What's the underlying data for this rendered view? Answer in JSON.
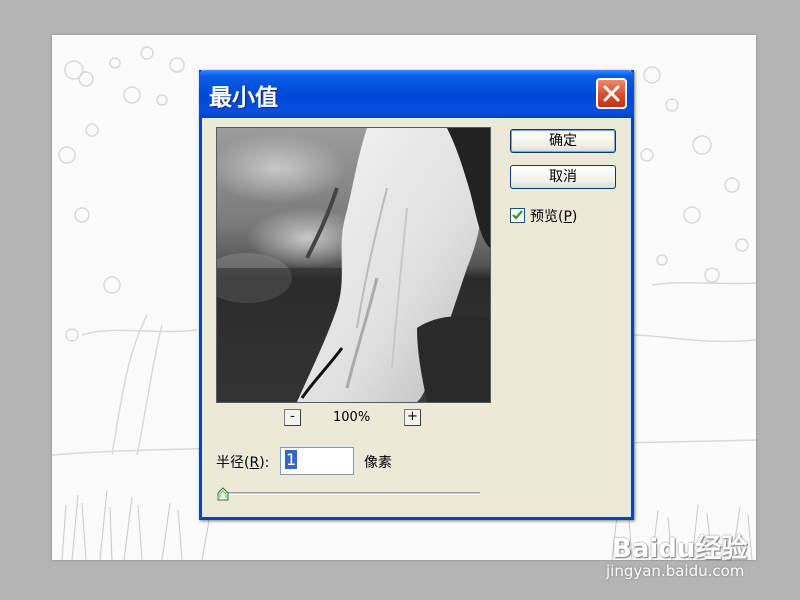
{
  "dialog": {
    "title": "最小值",
    "close_icon": "close-x-icon",
    "ok_label": "确定",
    "cancel_label": "取消",
    "preview_checkbox": {
      "checked": true,
      "label_prefix": "预览(",
      "mnemonic": "P",
      "label_suffix": ")"
    },
    "zoom": {
      "minus_label": "-",
      "plus_label": "+",
      "level": "100%"
    },
    "radius": {
      "label_prefix": "半径(",
      "mnemonic": "R",
      "label_suffix": "):",
      "value": "1",
      "unit": "像素"
    },
    "slider": {
      "value": 1
    }
  },
  "watermark": {
    "logo": "Baidu经验",
    "url": "jingyan.baidu.com"
  },
  "colors": {
    "titlebar": "#0047d6",
    "dialog_bg": "#ece9d8",
    "close_button": "#d8482a",
    "selection": "#316ac5",
    "check": "#21a121"
  }
}
